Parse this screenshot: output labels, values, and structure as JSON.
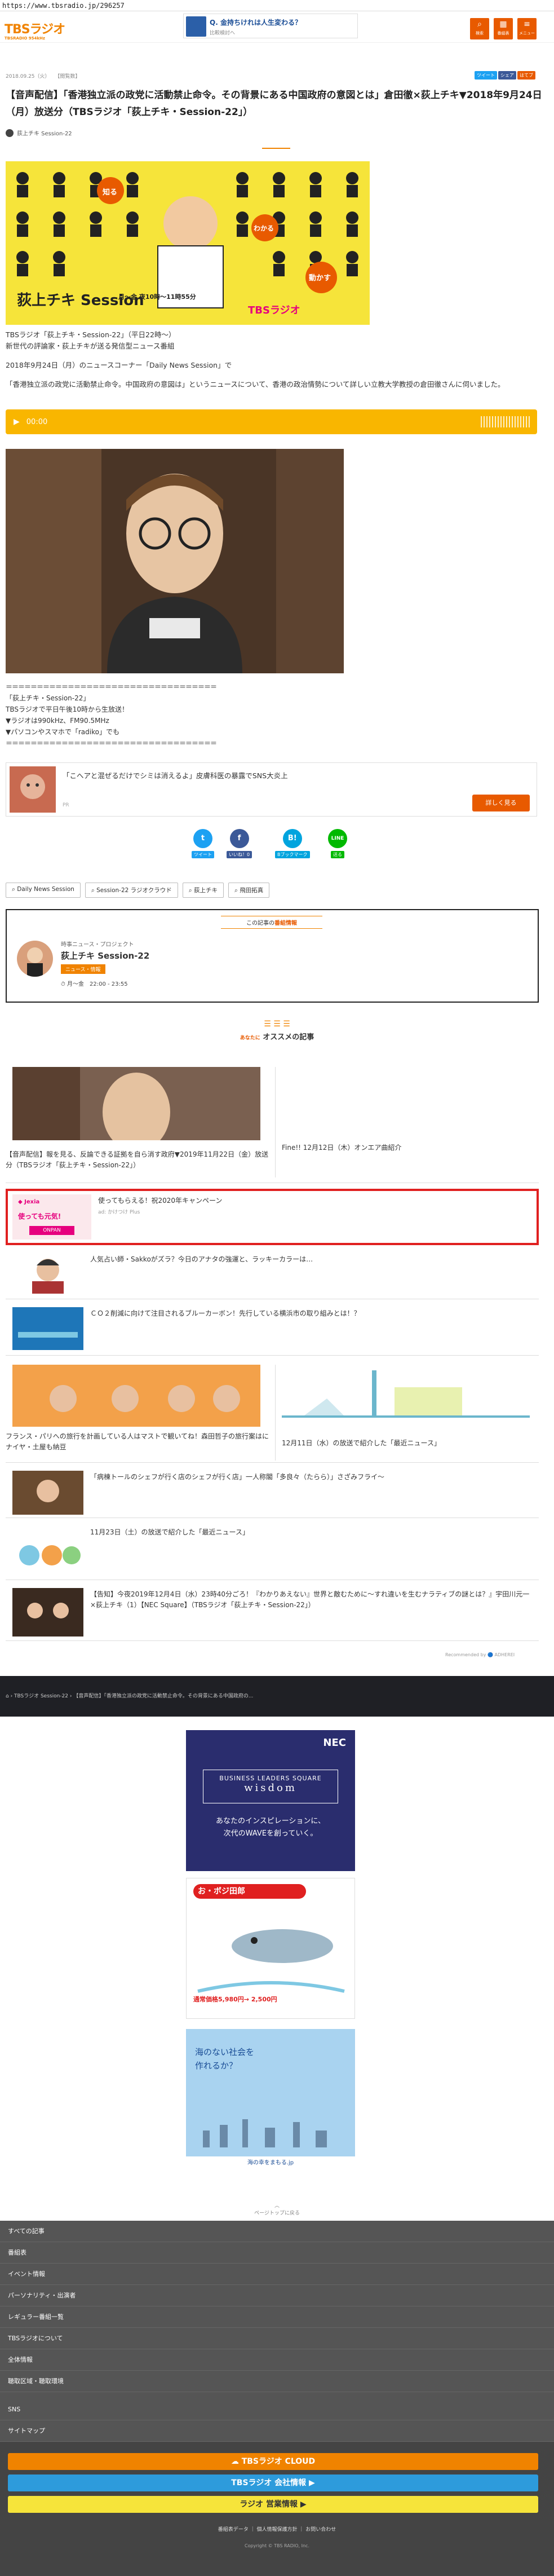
{
  "browser": {
    "url": "https://www.tbsradio.jp/296257"
  },
  "header": {
    "logo_text": "TBSラジオ",
    "logo_sub": "TBSRADIO 954kHz",
    "ad_title": "Q. 金持ちけれは人生変わる？",
    "ad_sub": "比較検討へ",
    "icons": [
      {
        "name": "search-icon",
        "label": "検索",
        "glyph": "⌕"
      },
      {
        "name": "schedule-icon",
        "label": "番組表",
        "glyph": "▦"
      },
      {
        "name": "menu-icon",
        "label": "メニュー",
        "glyph": "≡"
      }
    ],
    "accent": "#e85a00"
  },
  "article": {
    "date": "2018.09.25（火）",
    "views": "【閲覧数】",
    "share_labels": [
      "ツイート",
      "シェア",
      "はてブ"
    ],
    "title": "【音声配信】「香港独立派の政党に活動禁止命令。その背景にある中国政府の意図とは」倉田徹×荻上チキ▼2018年9月24日（月）放送分（TBSラジオ「荻上チキ・Session-22」）",
    "author": "荻上チキ Session-22",
    "hero_words": [
      "知る",
      "わかる",
      "動かす"
    ],
    "hero_show": "荻上チキ Session",
    "hero_time": "月〜金 夜10時〜11時55分",
    "hero_brand": "TBSラジオ",
    "intro_lines": [
      "TBSラジオ「荻上チキ・Session-22」（平日22時〜）",
      "新世代の評論家・荻上チキが送る発信型ニュース番組"
    ],
    "corner_line": "2018年9月24日（月）のニュースコーナー「Daily News Session」で",
    "topic_line": "「香港独立派の政党に活動禁止命令。中国政府の意図は」というニュースについて、香港の政治情勢について詳しい立教大学教授の倉田徹さんに伺いました。",
    "audio_time": "00:00",
    "info_rule": "＝＝＝＝＝＝＝＝＝＝＝＝＝＝＝＝＝＝＝＝＝＝＝＝＝＝＝＝＝＝＝＝＝＝",
    "info_lines": [
      "「荻上チキ・Session-22」",
      "TBSラジオで平日午後10時から生放送！",
      "▼ラジオは990kHz、FM90.5MHz",
      "▼パソコンやスマホで「radiko」でも"
    ]
  },
  "promo": {
    "text": "「こへアと混ぜるだけでシミは消えるよ」皮膚科医の暴露でSNS大炎上",
    "sponsor": "PR",
    "button": "詳しく見る"
  },
  "social": [
    {
      "name": "twitter",
      "glyph": "t",
      "label": "ツイート",
      "color": "#1da1f2"
    },
    {
      "name": "facebook",
      "glyph": "f",
      "label": "いいね！0",
      "color": "#3b5998"
    },
    {
      "name": "hatena",
      "glyph": "B!",
      "label": "Bブックマーク",
      "color": "#00a4de"
    },
    {
      "name": "line",
      "glyph": "LINE",
      "label": "送る",
      "color": "#00b900"
    }
  ],
  "tags": [
    "Daily News Session",
    "Session-22 ラジオクラウド",
    "荻上チキ",
    "飛田拓真"
  ],
  "program": {
    "heading": "この記事の",
    "heading_em": "番組情報",
    "category": "時事ニュース・プロジェクト",
    "name": "荻上チキ Session-22",
    "badge": "ニュース・情報",
    "time": "月〜金　22:00 - 23:55"
  },
  "recommend": {
    "title": "オススメの記事",
    "pre": "あなたに",
    "items": [
      {
        "title": "【音声配信】報を見る、反論できる証拠を自ら消す政府▼2019年11月22日（金）放送分（TBSラジオ「荻上チキ・Session-22」）"
      },
      {
        "title": "Fine!! 12月12日（木）オンエア曲紹介"
      },
      {
        "title": "使ってもらえる！祝2020年キャンペーン",
        "sub": "ad: かけつけ Plus"
      },
      {
        "title": "人気占い師・Sakkoがズラ？今日のアナタの強運と、ラッキーカラーは…"
      },
      {
        "title": "ＣＯ２削減に向けて注目されるブルーカーボン！先行している横浜市の取り組みとは！？"
      },
      {
        "title": "フランス・パリへの旅行を計画している人はマストで観いてね！森田哲子の旅行案はにナイヤ・土屋も納豆"
      },
      {
        "title": "12月11日（水）の放送で紹介した「最近ニュース」"
      },
      {
        "title": "「病棟トールのシェフが行く店のシェフが行く店」一人称閣「多良々（たらら）」さざみフライ〜"
      },
      {
        "title": "11月23日（土）の放送で紹介した「最近ニュース」"
      },
      {
        "title": "【告知】今夜2019年12月4日（水）23時40分ごろ！『わかりあえない』世界と敵むために〜すれ違いを生むナラティブの謎とは？』宇田川元一×荻上チキ（1）【NEC Square】（TBSラジオ「荻上チキ・Session-22」）"
      }
    ],
    "footer": "Recommended by 🔵 ADHEREI"
  },
  "breadcrumb_footer": [
    "TBSラジオ Session-22",
    "【音声配信】「香港独立派の政党に活動禁止命令。その背景にある中国政府の..."
  ],
  "ads": {
    "nec_logo": "NEC",
    "nec_box": "BUSINESS LEADERS SQUARE",
    "nec_word": "wisdom",
    "nec_line1": "あなたのインスピレーションに、",
    "nec_line2": "次代のWAVEを創っていく。",
    "kaiho_title": "お・ボジ田郎",
    "kaiho_price": "通常価格5,980円→ 2,500円",
    "ocean_line1": "海のない社会を",
    "ocean_line2": "作れるか？",
    "ocean_foot": "海の幸をまもる.jp"
  },
  "pagetop": "ページトップに戻る",
  "footer_nav": [
    "すべての記事",
    "番組表",
    "イベント情報",
    "パーソナリティ・出演者",
    "レギュラー番組一覧",
    "TBSラジオについて",
    "全体情報",
    "聴取区域・聴取環境",
    "SNS",
    "サイトマップ"
  ],
  "footer_buttons": [
    {
      "label": "TBSラジオ CLOUD",
      "bg": "#f08300",
      "color": "#fff"
    },
    {
      "label": "TBSラジオ 会社情報 ▶",
      "bg": "#2d9bdc",
      "color": "#fff"
    },
    {
      "label": "ラジオ 営業情報 ▶",
      "bg": "#f6e43a",
      "color": "#333"
    }
  ],
  "footer_links": "番組表データ ｜ 個人情報保護方針 ｜ お問い合わせ",
  "copyright": "Copyright © TBS RADIO, Inc."
}
